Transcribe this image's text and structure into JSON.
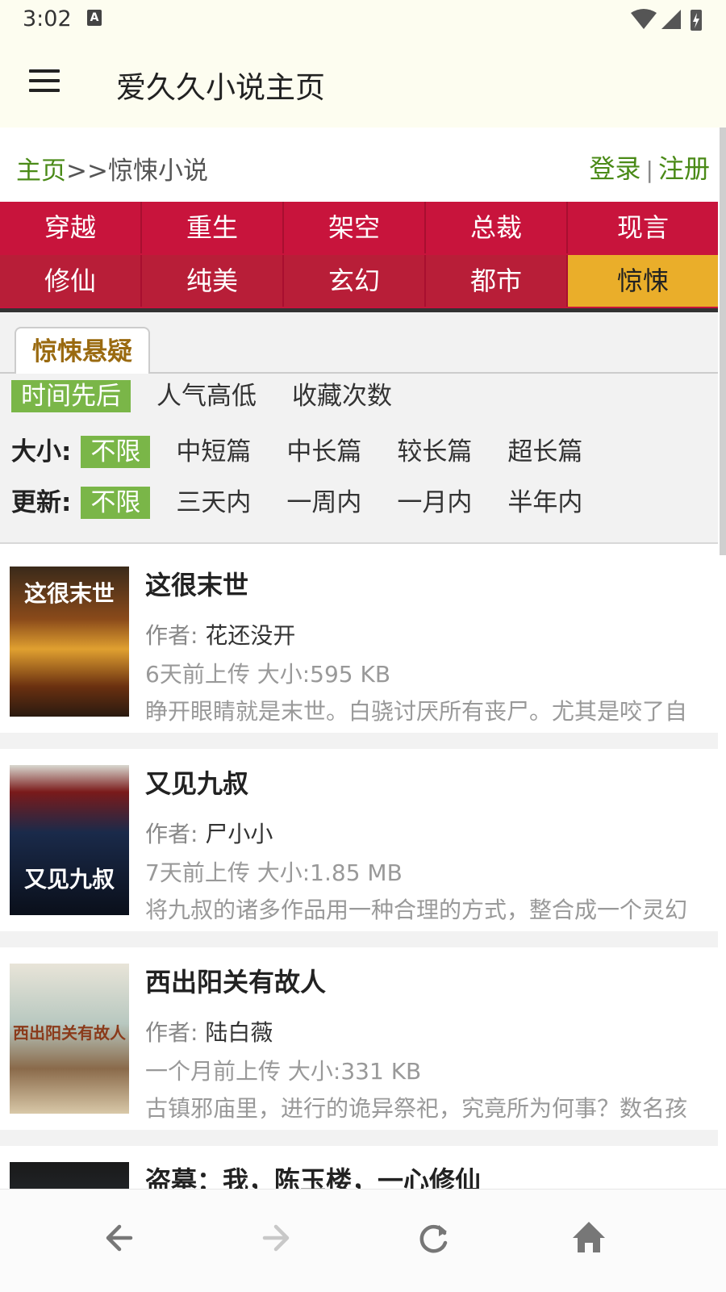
{
  "status": {
    "time": "3:02",
    "a_badge": "A"
  },
  "appbar": {
    "title": "爱久久小说主页",
    "menu_icon": "hamburger-menu-icon"
  },
  "breadcrumb": {
    "home": "主页",
    "separator": ">>",
    "current": "惊悚小说"
  },
  "auth": {
    "login": "登录",
    "divider": "|",
    "register": "注册"
  },
  "categories": {
    "row1": [
      "穿越",
      "重生",
      "架空",
      "总裁",
      "现言"
    ],
    "row2": [
      "修仙",
      "纯美",
      "玄幻",
      "都市",
      "惊悚"
    ],
    "active": "惊悚"
  },
  "filters": {
    "tab": "惊悚悬疑",
    "sort": [
      "时间先后",
      "人气高低",
      "收藏次数"
    ],
    "size_label": "大小:",
    "size": [
      "不限",
      "中短篇",
      "中长篇",
      "较长篇",
      "超长篇"
    ],
    "update_label": "更新:",
    "update": [
      "不限",
      "三天内",
      "一周内",
      "一月内",
      "半年内"
    ]
  },
  "books": [
    {
      "title": "这很末世",
      "author_label": "作者: ",
      "author": "花还没开",
      "uploaded": "6天前上传",
      "size": "大小:595 KB",
      "desc": "睁开眼睛就是末世。白骁讨厌所有丧尸。尤其是咬了自",
      "cover_text": "这很末世"
    },
    {
      "title": "又见九叔",
      "author_label": "作者: ",
      "author": "尸小小",
      "uploaded": "7天前上传",
      "size": "大小:1.85 MB",
      "desc": "将九叔的诸多作品用一种合理的方式，整合成一个灵幻",
      "cover_text": "又见九叔"
    },
    {
      "title": "西出阳关有故人",
      "author_label": "作者: ",
      "author": "陆白薇",
      "uploaded": "一个月前上传",
      "size": "大小:331 KB",
      "desc": "古镇邪庙里，进行的诡异祭祀，究竟所为何事？数名孩",
      "cover_text": "西出阳关有故人"
    },
    {
      "title": "盗墓：我，陈玉楼，一心修仙"
    }
  ],
  "colors": {
    "accent_green": "#4a8a17",
    "category_red": "#c8143c",
    "active_yellow": "#eaae2a",
    "chip_green": "#7ab648"
  },
  "navbar": {
    "icons": [
      "back-arrow-icon",
      "forward-arrow-icon",
      "refresh-icon",
      "home-icon"
    ]
  }
}
